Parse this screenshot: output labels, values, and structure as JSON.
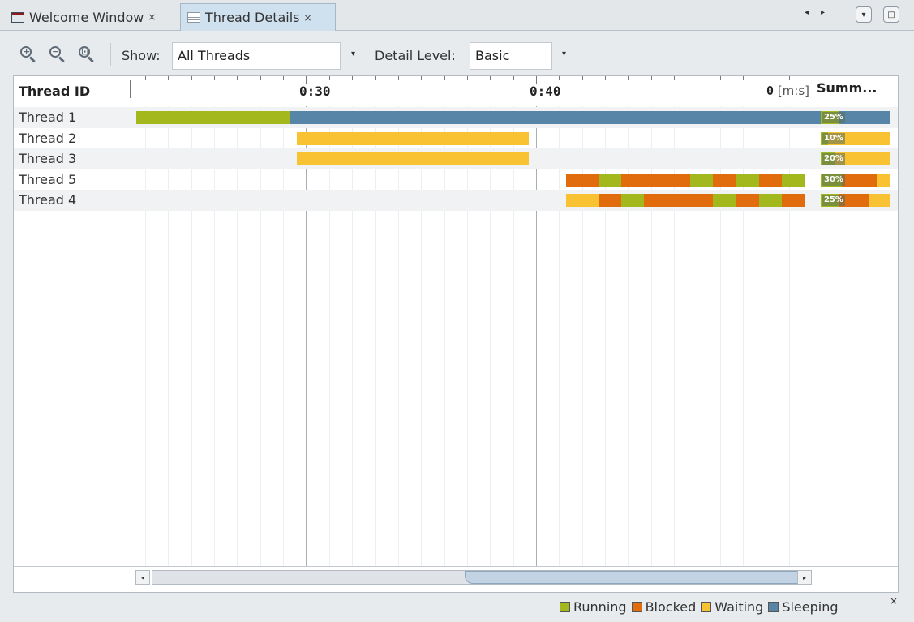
{
  "tabs": [
    {
      "label": "Welcome Window",
      "close": "×"
    },
    {
      "label": "Thread Details",
      "close": "×"
    }
  ],
  "tab_nav": {
    "left": "◂",
    "right": "▸",
    "menu": "▾",
    "restore": "□"
  },
  "toolbar": {
    "zoom_in_sign": "+",
    "zoom_out_sign": "−",
    "zoom_fit_sign": "⊡",
    "show_label": "Show:",
    "show_value": "All Threads",
    "detail_label": "Detail Level:",
    "detail_value": "Basic",
    "arrow": "▾"
  },
  "header": {
    "thread_id": "Thread ID",
    "tick_030": "0:30",
    "tick_040": "0:40",
    "tick_end": "0",
    "unit": "[m:s]",
    "summary": "Summ..."
  },
  "colors": {
    "running": "#a2b81d",
    "blocked": "#e06c0e",
    "waiting": "#f8c232",
    "sleeping": "#5785a8"
  },
  "threads": [
    {
      "name": "Thread 1",
      "summary_pct": "25%",
      "summary": [
        {
          "state": "running",
          "frac": 0.25
        },
        {
          "state": "sleeping",
          "frac": 0.75
        }
      ],
      "segments": [
        {
          "state": "running",
          "start": 22.6,
          "end": 29.3
        },
        {
          "state": "sleeping",
          "start": 29.3,
          "end": 52.4
        }
      ]
    },
    {
      "name": "Thread 2",
      "summary_pct": "10%",
      "summary": [
        {
          "state": "running",
          "frac": 0.1
        },
        {
          "state": "waiting",
          "frac": 0.9
        }
      ],
      "segments": [
        {
          "state": "waiting",
          "start": 29.6,
          "end": 39.7
        }
      ]
    },
    {
      "name": "Thread 3",
      "summary_pct": "20%",
      "summary": [
        {
          "state": "running",
          "frac": 0.2
        },
        {
          "state": "waiting",
          "frac": 0.8
        }
      ],
      "segments": [
        {
          "state": "waiting",
          "start": 29.6,
          "end": 39.7
        }
      ]
    },
    {
      "name": "Thread 5",
      "summary_pct": "30%",
      "summary": [
        {
          "state": "running",
          "frac": 0.3
        },
        {
          "state": "blocked",
          "frac": 0.5
        },
        {
          "state": "waiting",
          "frac": 0.2
        }
      ],
      "segments": [
        {
          "state": "blocked",
          "start": 41.3,
          "end": 42.7
        },
        {
          "state": "running",
          "start": 42.7,
          "end": 43.7
        },
        {
          "state": "blocked",
          "start": 43.7,
          "end": 46.7
        },
        {
          "state": "running",
          "start": 46.7,
          "end": 47.7
        },
        {
          "state": "blocked",
          "start": 47.7,
          "end": 48.7
        },
        {
          "state": "running",
          "start": 48.7,
          "end": 49.7
        },
        {
          "state": "blocked",
          "start": 49.7,
          "end": 50.7
        },
        {
          "state": "running",
          "start": 50.7,
          "end": 51.7
        }
      ]
    },
    {
      "name": "Thread 4",
      "summary_pct": "25%",
      "summary": [
        {
          "state": "running",
          "frac": 0.25
        },
        {
          "state": "blocked",
          "frac": 0.45
        },
        {
          "state": "waiting",
          "frac": 0.3
        }
      ],
      "segments": [
        {
          "state": "waiting",
          "start": 41.3,
          "end": 42.7
        },
        {
          "state": "blocked",
          "start": 42.7,
          "end": 43.7
        },
        {
          "state": "running",
          "start": 43.7,
          "end": 44.7
        },
        {
          "state": "blocked",
          "start": 44.7,
          "end": 47.7
        },
        {
          "state": "running",
          "start": 47.7,
          "end": 48.7
        },
        {
          "state": "blocked",
          "start": 48.7,
          "end": 49.7
        },
        {
          "state": "running",
          "start": 49.7,
          "end": 50.7
        },
        {
          "state": "blocked",
          "start": 50.7,
          "end": 51.7
        }
      ]
    }
  ],
  "scroll": {
    "left": "◂",
    "right": "▸"
  },
  "legend": [
    {
      "label": "Running",
      "state": "running"
    },
    {
      "label": "Blocked",
      "state": "blocked"
    },
    {
      "label": "Waiting",
      "state": "waiting"
    },
    {
      "label": "Sleeping",
      "state": "sleeping"
    }
  ],
  "legend_close": "×"
}
